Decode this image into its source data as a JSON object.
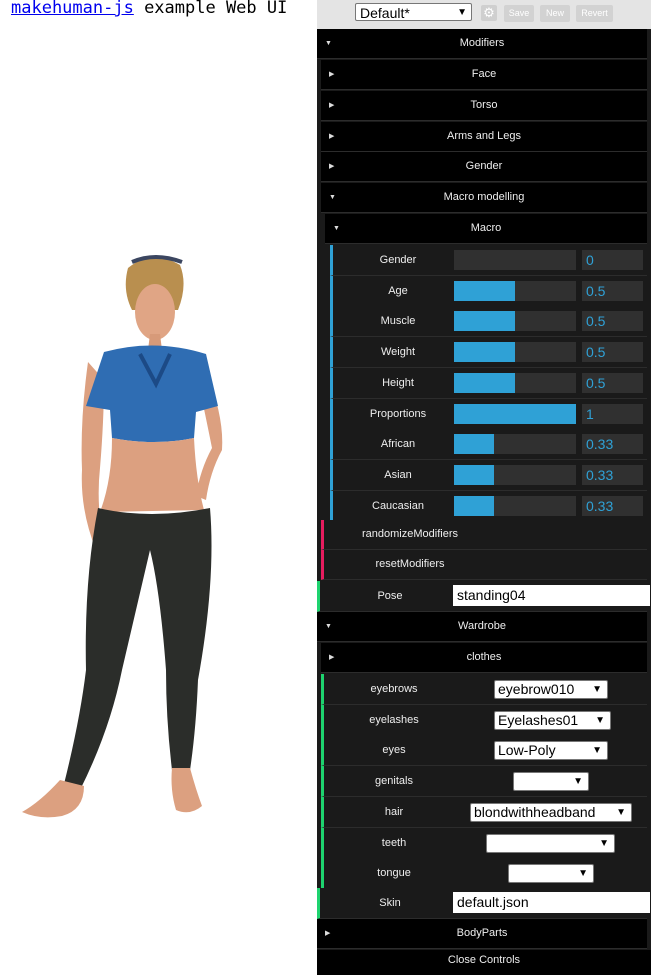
{
  "header": {
    "link_text": "makehuman-js",
    "rest_text": " example Web UI"
  },
  "topbar": {
    "preset": "Default*",
    "save": "Save",
    "new": "New",
    "revert": "Revert"
  },
  "folders": {
    "modifiers": "Modifiers",
    "face": "Face",
    "torso": "Torso",
    "arms_legs": "Arms and Legs",
    "gender": "Gender",
    "macro_modelling": "Macro modelling",
    "macro": "Macro",
    "wardrobe": "Wardrobe",
    "clothes": "clothes",
    "bodyparts": "BodyParts"
  },
  "macro_sliders": [
    {
      "label": "Gender",
      "value": "0",
      "fraction": 0
    },
    {
      "label": "Age",
      "value": "0.5",
      "fraction": 0.5
    },
    {
      "label": "Muscle",
      "value": "0.5",
      "fraction": 0.5
    },
    {
      "label": "Weight",
      "value": "0.5",
      "fraction": 0.5
    },
    {
      "label": "Height",
      "value": "0.5",
      "fraction": 0.5
    },
    {
      "label": "Proportions",
      "value": "1",
      "fraction": 1
    },
    {
      "label": "African",
      "value": "0.33",
      "fraction": 0.33
    },
    {
      "label": "Asian",
      "value": "0.33",
      "fraction": 0.33
    },
    {
      "label": "Caucasian",
      "value": "0.33",
      "fraction": 0.33
    }
  ],
  "functions": {
    "randomize": "randomizeModifiers",
    "reset": "resetModifiers"
  },
  "pose": {
    "label": "Pose",
    "value": "standing04"
  },
  "proxies": [
    {
      "label": "eyebrows",
      "value": "eyebrow010"
    },
    {
      "label": "eyelashes",
      "value": "Eyelashes01"
    },
    {
      "label": "eyes",
      "value": "Low-Poly"
    },
    {
      "label": "genitals",
      "value": ""
    },
    {
      "label": "hair",
      "value": "blondwithheadband"
    },
    {
      "label": "teeth",
      "value": ""
    },
    {
      "label": "tongue",
      "value": ""
    }
  ],
  "skin": {
    "label": "Skin",
    "value": "default.json"
  },
  "close": "Close Controls",
  "colors": {
    "slider": "#2fa1d6",
    "function": "#e61d5f",
    "string": "#1ed36f"
  }
}
